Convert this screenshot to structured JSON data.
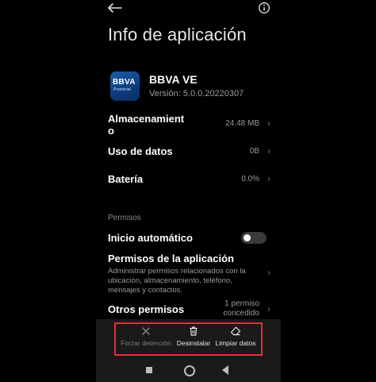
{
  "header": {
    "title": "Info de aplicación"
  },
  "app": {
    "name": "BBVA VE",
    "version": "Versión: 5.0.0.20220307",
    "icon_logo_text": "BBVA",
    "icon_sub_text": "Provincial"
  },
  "rows": {
    "storage": {
      "label_line1": "Almacenamient",
      "label_line2": "o",
      "value": "24.48 MB"
    },
    "data": {
      "label": "Uso de datos",
      "value": "0B"
    },
    "battery": {
      "label": "Batería",
      "value": "0.0%"
    }
  },
  "permissions_section": {
    "heading": "Permisos",
    "autostart_label": "Inicio automático",
    "autostart_on": false,
    "app_permissions_label": "Permisos de la aplicación",
    "app_permissions_desc": "Administrar permisos relacionados con la ubicación, almacenamiento, teléfono, mensajes y contactos.",
    "other_permissions_label": "Otros permisos",
    "other_permissions_value_line1": "1 permiso",
    "other_permissions_value_line2": "concedido"
  },
  "actions": {
    "force_stop": "Forzar detención",
    "uninstall": "Desinstalar",
    "clear_data": "Limpiar datos"
  },
  "colors": {
    "background": "#000000",
    "bottom_bar": "#1a1a1a",
    "highlight_box": "#e03131",
    "secondary_text": "#9a9a9a"
  }
}
